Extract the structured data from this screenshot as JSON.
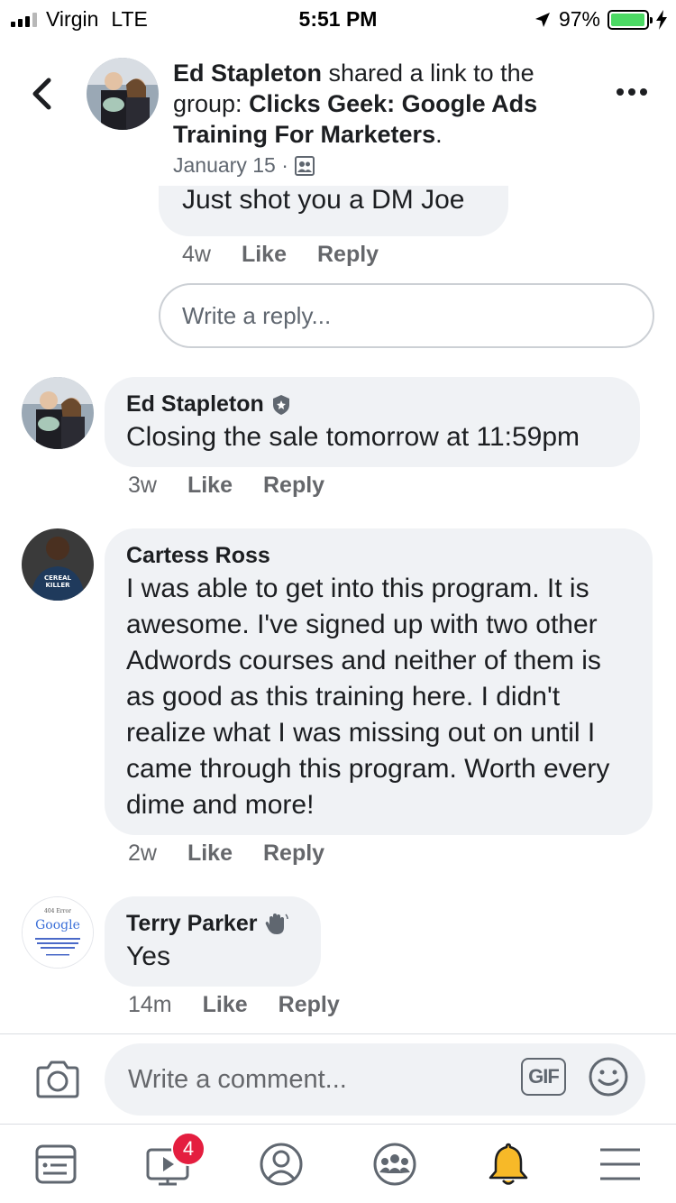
{
  "status_bar": {
    "carrier": "Virgin",
    "network": "LTE",
    "time": "5:51 PM",
    "battery_percent": "97%",
    "battery_level": 0.97
  },
  "header": {
    "author": "Ed Stapleton",
    "shared_text": " shared a link to the group: ",
    "group_name": "Clicks Geek: Google Ads Training For Marketers",
    "period": ".",
    "date": "January 15 ·",
    "privacy_icon": "group-privacy-icon"
  },
  "previous_reply": {
    "text": "Just shot you a DM Joe",
    "time": "4w",
    "like": "Like",
    "reply": "Reply"
  },
  "reply_box": {
    "placeholder": "Write a reply..."
  },
  "comments": [
    {
      "author": "Ed Stapleton",
      "badge_icon": "admin-badge-icon",
      "text": "Closing the sale tomorrow at 11:59pm",
      "time": "3w",
      "like": "Like",
      "reply": "Reply"
    },
    {
      "author": "Cartess Ross",
      "avatar_shirt_text": "CEREAL KILLER",
      "text": "I was able to get into this program. It is awesome. I've signed up with two other Adwords courses and neither of them is as good as this training here. I didn't realize what I was missing out on until I came through this program. Worth every dime and more!",
      "time": "2w",
      "like": "Like",
      "reply": "Reply"
    },
    {
      "author": "Terry Parker",
      "badge_icon": "new-member-wave-icon",
      "avatar_logo_top": "404 Error",
      "avatar_logo": "Google",
      "text": "Yes",
      "time": "14m",
      "like": "Like",
      "reply": "Reply"
    }
  ],
  "composer": {
    "placeholder": "Write a comment...",
    "gif_label": "GIF"
  },
  "tabbar": {
    "video_badge": "4",
    "active_color": "#f7b928",
    "icons": [
      "news-feed-icon",
      "watch-icon",
      "profile-icon",
      "groups-icon",
      "notifications-icon",
      "menu-icon"
    ]
  }
}
